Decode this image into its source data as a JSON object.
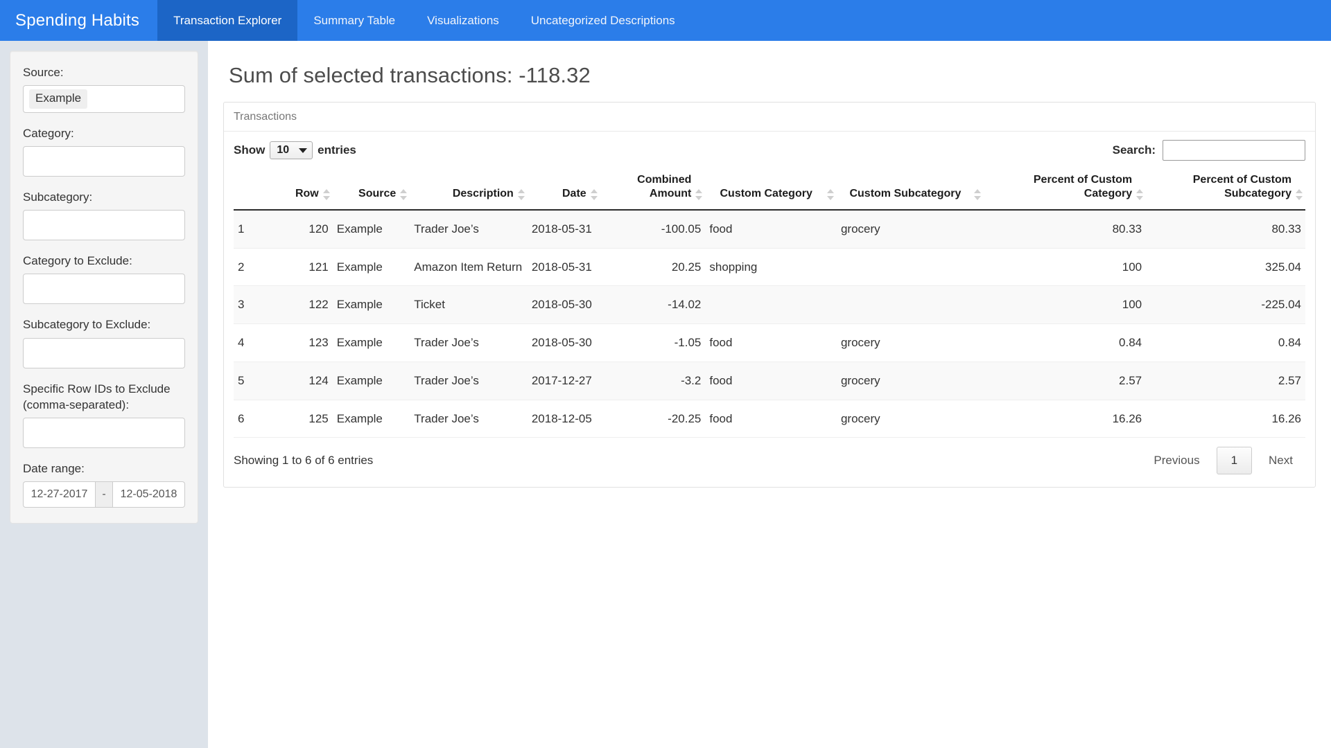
{
  "navbar": {
    "brand": "Spending Habits",
    "tabs": [
      {
        "label": "Transaction Explorer",
        "active": true
      },
      {
        "label": "Summary Table",
        "active": false
      },
      {
        "label": "Visualizations",
        "active": false
      },
      {
        "label": "Uncategorized Descriptions",
        "active": false
      }
    ]
  },
  "sidebar": {
    "source": {
      "label": "Source:",
      "value": "Example"
    },
    "category": {
      "label": "Category:",
      "value": ""
    },
    "subcategory": {
      "label": "Subcategory:",
      "value": ""
    },
    "category_exclude": {
      "label": "Category to Exclude:",
      "value": ""
    },
    "subcategory_exclude": {
      "label": "Subcategory to Exclude:",
      "value": ""
    },
    "row_ids_exclude": {
      "label": "Specific Row IDs to Exclude (comma-separated):",
      "value": ""
    },
    "date_range": {
      "label": "Date range:",
      "start": "12-27-2017",
      "separator": "-",
      "end": "12-05-2018"
    }
  },
  "main": {
    "sum_title": "Sum of selected transactions: -118.32",
    "card_title": "Transactions",
    "controls": {
      "show_label": "Show",
      "entries_label": "entries",
      "page_length": "10",
      "search_label": "Search:",
      "search_value": "",
      "search_placeholder": ""
    },
    "table": {
      "columns": [
        {
          "label": "",
          "align": "center",
          "sortable": false
        },
        {
          "label": "Row",
          "align": "right",
          "sortable": true
        },
        {
          "label": "Source",
          "align": "right",
          "sortable": true
        },
        {
          "label": "Description",
          "align": "right",
          "sortable": true
        },
        {
          "label": "Date",
          "align": "right",
          "sortable": true
        },
        {
          "label": "Combined Amount",
          "align": "right",
          "sortable": true
        },
        {
          "label": "Custom Category",
          "align": "center",
          "sortable": true
        },
        {
          "label": "Custom Subcategory",
          "align": "center",
          "sortable": true
        },
        {
          "label": "Percent of Custom Category",
          "align": "right",
          "sortable": true
        },
        {
          "label": "Percent of Custom Subcategory",
          "align": "right",
          "sortable": true
        }
      ],
      "rows": [
        {
          "index": "1",
          "row": "120",
          "source": "Example",
          "description": "Trader Joe’s",
          "date": "2018-05-31",
          "amount": "-100.05",
          "category": "food",
          "subcategory": "grocery",
          "pct_category": "80.33",
          "pct_subcategory": "80.33"
        },
        {
          "index": "2",
          "row": "121",
          "source": "Example",
          "description": "Amazon Item Return",
          "date": "2018-05-31",
          "amount": "20.25",
          "category": "shopping",
          "subcategory": "",
          "pct_category": "100",
          "pct_subcategory": "325.04"
        },
        {
          "index": "3",
          "row": "122",
          "source": "Example",
          "description": "Ticket",
          "date": "2018-05-30",
          "amount": "-14.02",
          "category": "",
          "subcategory": "",
          "pct_category": "100",
          "pct_subcategory": "-225.04"
        },
        {
          "index": "4",
          "row": "123",
          "source": "Example",
          "description": "Trader Joe’s",
          "date": "2018-05-30",
          "amount": "-1.05",
          "category": "food",
          "subcategory": "grocery",
          "pct_category": "0.84",
          "pct_subcategory": "0.84"
        },
        {
          "index": "5",
          "row": "124",
          "source": "Example",
          "description": "Trader Joe’s",
          "date": "2017-12-27",
          "amount": "-3.2",
          "category": "food",
          "subcategory": "grocery",
          "pct_category": "2.57",
          "pct_subcategory": "2.57"
        },
        {
          "index": "6",
          "row": "125",
          "source": "Example",
          "description": "Trader Joe’s",
          "date": "2018-12-05",
          "amount": "-20.25",
          "category": "food",
          "subcategory": "grocery",
          "pct_category": "16.26",
          "pct_subcategory": "16.26"
        }
      ]
    },
    "footer": {
      "info": "Showing 1 to 6 of 6 entries",
      "previous": "Previous",
      "page": "1",
      "next": "Next"
    }
  },
  "colors": {
    "navbar": "#2b7de9",
    "navbar_active": "#1c65c6",
    "page_gutter": "#dde3ea",
    "well": "#f5f5f5",
    "stripe": "#f9f9f9"
  }
}
